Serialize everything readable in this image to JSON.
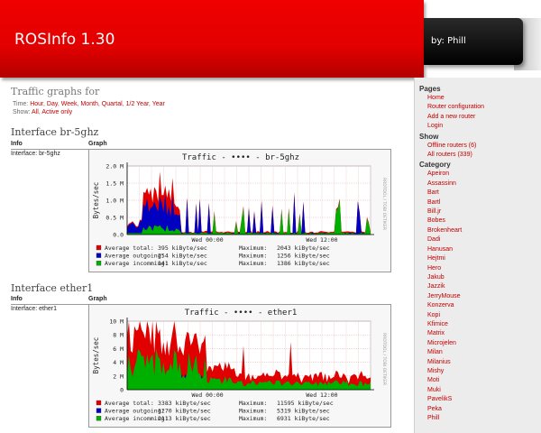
{
  "header": {
    "title": "ROSInfo 1.30",
    "author": "by: Phill"
  },
  "main": {
    "page_title": "Traffic graphs for",
    "time_label": "Time:",
    "time_options": [
      "Hour",
      "Day",
      "Week",
      "Month",
      "Quartal",
      "1/2 Year",
      "Year"
    ],
    "show_label": "Show:",
    "show_options": [
      "All",
      "Active only"
    ],
    "table_headers": {
      "info": "Info",
      "graph": "Graph"
    }
  },
  "interfaces": [
    {
      "title": "Interface br-5ghz",
      "info": "Interface: br-5ghz",
      "graph": {
        "title": "Traffic - •••• - br-5ghz",
        "ylabel": "Bytes/sec",
        "yticks": [
          "2.0 M",
          "1.5 M",
          "1.0 M",
          "0.5 M",
          "0.0"
        ],
        "xticks": [
          "Wed 00:00",
          "Wed 12:00"
        ],
        "side_text": "RRDTOOL / TOBI OETIKER",
        "legend": [
          {
            "name": "Average total:",
            "avg": "395 kiByte/sec",
            "max_label": "Maximum:",
            "max": "2043 kiByte/sec",
            "color": "#e00000"
          },
          {
            "name": "Average outgoing:",
            "avg": "254 kiByte/sec",
            "max_label": "Maximum:",
            "max": "1256 kiByte/sec",
            "color": "#0000c0"
          },
          {
            "name": "Average incomming:",
            "avg": "141 kiByte/sec",
            "max_label": "Maximum:",
            "max": "1386 kiByte/sec",
            "color": "#00b000"
          }
        ]
      }
    },
    {
      "title": "Interface ether1",
      "info": "Interface: ether1",
      "graph": {
        "title": "Traffic - •••• - ether1",
        "ylabel": "Bytes/sec",
        "yticks": [
          "10 M",
          "8 M",
          "6 M",
          "4 M",
          "2 M",
          "0"
        ],
        "xticks": [
          "Wed 00:00",
          "Wed 12:00"
        ],
        "side_text": "RRDTOOL / TOBI OETIKER",
        "legend": [
          {
            "name": "Average total:",
            "avg": "3383 kiByte/sec",
            "max_label": "Maximum:",
            "max": "11595 kiByte/sec",
            "color": "#e00000"
          },
          {
            "name": "Average outgoing:",
            "avg": "1270 kiByte/sec",
            "max_label": "Maximum:",
            "max": "5319 kiByte/sec",
            "color": "#0000c0"
          },
          {
            "name": "Average incomming:",
            "avg": "2113 kiByte/sec",
            "max_label": "Maximum:",
            "max": "6931 kiByte/sec",
            "color": "#00b000"
          }
        ]
      }
    }
  ],
  "sidebar": {
    "pages_heading": "Pages",
    "pages": [
      "Home",
      "Router configuration",
      "Add a new router",
      "Login"
    ],
    "show_heading": "Show",
    "show": [
      "Offline routers (6)",
      "All routers (339)"
    ],
    "category_heading": "Category",
    "categories": [
      "Apeiron",
      "Assassinn",
      "Bart",
      "Bartl",
      "Bill.jr",
      "Bobes",
      "Brokenheart",
      "Dadi",
      "Hanusan",
      "Hejtmi",
      "Hero",
      "Jakub",
      "Jazzik",
      "JerryMouse",
      "Konzerva",
      "Kopi",
      "Kfimice",
      "Matrix",
      "Microjelen",
      "Milan",
      "Milanius",
      "Mishy",
      "Moti",
      "Muki",
      "PavelikS",
      "Peka",
      "Phill"
    ]
  },
  "colors": {
    "header_red": "#e20000",
    "header_dark": "#111111",
    "link": "#c00000",
    "total": "#e00000",
    "outgoing": "#0000c0",
    "incoming": "#00b000"
  }
}
